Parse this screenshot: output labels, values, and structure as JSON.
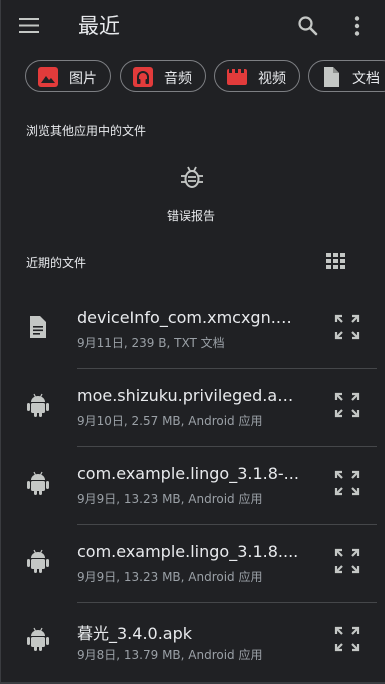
{
  "appbar": {
    "title": "最近",
    "menu_icon": "hamburger-menu-icon",
    "search_icon": "search-icon",
    "more_icon": "more-vert-icon"
  },
  "chips": [
    {
      "label": "图片",
      "icon": "image-icon",
      "color": "#e23b3b"
    },
    {
      "label": "音频",
      "icon": "headphones-icon",
      "color": "#e23b3b"
    },
    {
      "label": "视频",
      "icon": "movie-icon",
      "color": "#e23b3b"
    },
    {
      "label": "文档",
      "icon": "document-icon",
      "color": "#c4c7c5"
    }
  ],
  "other_apps": {
    "label": "浏览其他应用中的文件",
    "items": [
      {
        "label": "错误报告",
        "icon": "bug-icon"
      }
    ]
  },
  "recent": {
    "label": "近期的文件",
    "view_toggle_icon": "grid-view-icon",
    "files": [
      {
        "name": "deviceInfo_com.xmcxgn.zl...",
        "meta": "9月11日, 239 B, TXT 文档",
        "icon": "text-file-icon"
      },
      {
        "name": "moe.shizuku.privileged.api...",
        "meta": "9月10日, 2.57 MB, Android 应用",
        "icon": "android-icon"
      },
      {
        "name": "com.example.lingo_3.1.8-...",
        "meta": "9月9日, 13.23 MB, Android 应用",
        "icon": "android-icon"
      },
      {
        "name": "com.example.lingo_3.1.8....",
        "meta": "9月9日, 13.23 MB, Android 应用",
        "icon": "android-icon"
      },
      {
        "name": "暮光_3.4.0.apk",
        "meta": "9月8日, 13.79 MB, Android 应用",
        "icon": "android-icon"
      }
    ]
  },
  "colors": {
    "background": "#202124",
    "text": "#e8eaed",
    "secondary_text": "#9aa0a6",
    "chip_accent": "#e23b3b",
    "icon": "#c4c7c5"
  }
}
